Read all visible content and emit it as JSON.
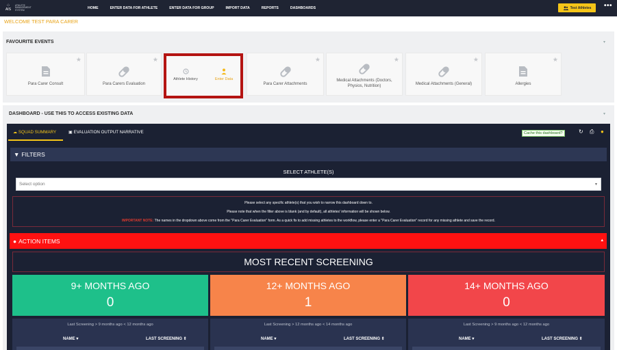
{
  "nav": {
    "logo_line1": "AIS",
    "logo_text": "ATHLETE MANAGEMENT SYSTEM",
    "items": [
      "HOME",
      "ENTER DATA FOR ATHLETE",
      "ENTER DATA FOR GROUP",
      "IMPORT DATA",
      "REPORTS",
      "DASHBOARDS"
    ],
    "user_button": "Test Athletes",
    "more": "•••"
  },
  "welcome": "WELCOME TEST PARA CARER",
  "favourites": {
    "header": "FAVOURITE EVENTS",
    "cards": [
      {
        "label": "Para Carer Consult",
        "icon": "document-icon"
      },
      {
        "label": "Para Carers Evaluation",
        "icon": "pill-icon"
      },
      {
        "label": "Athlete History",
        "icon": "history-icon"
      },
      {
        "label": "Enter Data",
        "icon": "person-icon"
      },
      {
        "label": "Para Carer Attachments",
        "icon": "pill-icon"
      },
      {
        "label": "Medical Attachments (Doctors, Physios, Nutrition)",
        "icon": "pill-icon"
      },
      {
        "label": "Medical Attachments (General)",
        "icon": "pill-icon"
      },
      {
        "label": "Allergies",
        "icon": "document-icon"
      }
    ]
  },
  "dashboard": {
    "header": "DASHBOARD - USE THIS TO ACCESS EXISTING DATA",
    "tabs": [
      "SQUAD SUMMARY",
      "EVALUATION OUTPUT NARRATIVE"
    ],
    "cache_label": "Cache this dashboard?",
    "filters_label": "FILTERS",
    "select_label": "SELECT ATHLETE(S)",
    "select_placeholder": "Select option",
    "note_1": "Please select any specific athlete(s) that you wish to narrow this dashboard down to.",
    "note_2": "Please note that when the filter above is blank (and by default), all athletes' information will be shown below.",
    "note_3_label": "IMPORTANT NOTE:",
    "note_3": "The names in the dropdown above come from the \"Para Carer Evaluation\" form. As a quick fix to add missing athletes to the workflow, please enter a \"Para Carer Evaluation\" record for any missing athlete and save the record.",
    "action_items": "ACTION ITEMS",
    "most_recent": "MOST RECENT SCREENING",
    "stats": [
      {
        "title": "9+ MONTHS AGO",
        "value": "0",
        "color": "#1ec08a",
        "caption": "Last Screening > 9 months ago < 12 months ago"
      },
      {
        "title": "12+ MONTHS AGO",
        "value": "1",
        "color": "#f7844a",
        "caption": "Last Screening > 12 months ago < 14 months ago"
      },
      {
        "title": "14+ MONTHS AGO",
        "value": "0",
        "color": "#f2464a",
        "caption": "Last Screening > 9 months ago < 12 months ago"
      }
    ],
    "col_name": "NAME ▾",
    "col_last": "LAST SCREENING ⇕"
  }
}
